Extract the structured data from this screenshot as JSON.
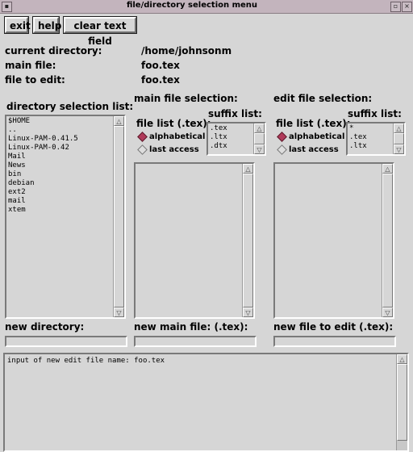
{
  "window": {
    "title": "file/directory selection menu",
    "controls": {
      "left": "▪",
      "right1": "▫",
      "right2": "×"
    }
  },
  "toolbar": {
    "exit_label": "exit",
    "help_label": "help",
    "clear_label": "clear text field"
  },
  "info": {
    "current_directory_label": "current directory:",
    "current_directory_value": "/home/johnsonm",
    "main_file_label": "main file:",
    "main_file_value": "foo.tex",
    "file_to_edit_label": "file to edit:",
    "file_to_edit_value": "foo.tex"
  },
  "directory_panel": {
    "heading": "directory selection list:",
    "items": [
      "$HOME",
      "..",
      "Linux-PAM-0.41.5",
      "Linux-PAM-0.42",
      "Mail",
      "News",
      "bin",
      "debian",
      "ext2",
      "mail",
      "xtem"
    ]
  },
  "main_panel": {
    "heading": "main file selection:",
    "file_list_label": "file list (.tex):",
    "suffix_label": "suffix list:",
    "suffixes": [
      ".tex",
      ".ltx",
      ".dtx"
    ],
    "sort_alpha": "alphabetical",
    "sort_access": "last access"
  },
  "edit_panel": {
    "heading": "edit file selection:",
    "file_list_label": "file list (.tex):",
    "suffix_label": "suffix list:",
    "suffixes": [
      "*",
      ".tex",
      ".ltx"
    ],
    "sort_alpha": "alphabetical",
    "sort_access": "last access"
  },
  "bottom_fields": {
    "new_directory_label": "new directory:",
    "new_main_file_label": "new main file: (.tex):",
    "new_edit_file_label": "new file to edit (.tex):"
  },
  "message_area": {
    "text": "input of new edit file name: foo.tex"
  },
  "icons": {
    "arrow_up": "△",
    "arrow_down": "▽"
  }
}
